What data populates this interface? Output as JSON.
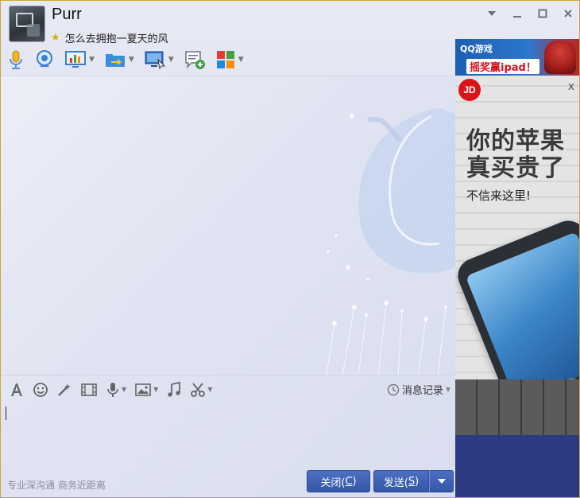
{
  "contact": {
    "name": "Purr",
    "signature": "怎么去拥抱一夏天的风"
  },
  "window_controls": [
    "menu",
    "minimize",
    "maximize",
    "close"
  ],
  "toolbar": {
    "items": [
      {
        "icon": "voice-call-icon",
        "dropdown": false
      },
      {
        "icon": "video-call-icon",
        "dropdown": false
      },
      {
        "icon": "remote-desktop-icon",
        "dropdown": true
      },
      {
        "icon": "send-file-icon",
        "dropdown": true
      },
      {
        "icon": "screen-share-icon",
        "dropdown": true
      },
      {
        "icon": "create-discussion-icon",
        "dropdown": false
      },
      {
        "icon": "apps-icon",
        "dropdown": true
      }
    ]
  },
  "input_toolbar": {
    "items": [
      {
        "icon": "font-icon",
        "dropdown": false
      },
      {
        "icon": "emoji-icon",
        "dropdown": false
      },
      {
        "icon": "magic-wand-icon",
        "dropdown": false
      },
      {
        "icon": "gif-icon",
        "dropdown": false
      },
      {
        "icon": "voice-message-icon",
        "dropdown": true
      },
      {
        "icon": "image-icon",
        "dropdown": true
      },
      {
        "icon": "music-icon",
        "dropdown": false
      },
      {
        "icon": "screenshot-scissors-icon",
        "dropdown": true
      }
    ],
    "history_label": "消息记录"
  },
  "footer": {
    "slogan": "专业深沟通 商务近距离",
    "close_label": "关闭(",
    "close_key": "C",
    "close_end": ")",
    "send_label": "发送(",
    "send_key": "S",
    "send_end": ")"
  },
  "ad_top": {
    "logo_text": "QQ游戏",
    "promo_text": "摇奖赢ipad！"
  },
  "ad_main": {
    "brand": "JD",
    "close": "x",
    "headline_1": "你的苹果",
    "headline_2": "真买贵了",
    "subline": "不信来这里!"
  },
  "colors": {
    "accent": "#3656a8",
    "border": "#c9a63a",
    "background": "#dfe3f1"
  }
}
